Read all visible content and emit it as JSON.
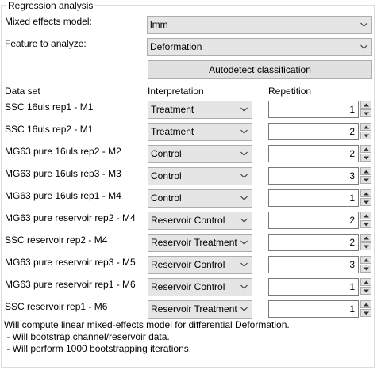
{
  "group_title": "Regression analysis",
  "model": {
    "label": "Mixed effects model:",
    "value": "lmm"
  },
  "feature": {
    "label": "Feature to analyze:",
    "value": "Deformation"
  },
  "autodetect_label": "Autodetect classification",
  "headers": {
    "dataset": "Data set",
    "interpretation": "Interpretation",
    "repetition": "Repetition"
  },
  "rows": [
    {
      "name": "SSC 16uls rep1 - M1",
      "interpretation": "Treatment",
      "repetition": "1"
    },
    {
      "name": "SSC 16uls rep2 - M1",
      "interpretation": "Treatment",
      "repetition": "2"
    },
    {
      "name": "MG63 pure 16uls rep2 - M2",
      "interpretation": "Control",
      "repetition": "2"
    },
    {
      "name": "MG63 pure 16uls rep3 - M3",
      "interpretation": "Control",
      "repetition": "3"
    },
    {
      "name": "MG63 pure 16uls rep1 - M4",
      "interpretation": "Control",
      "repetition": "1"
    },
    {
      "name": "MG63 pure reservoir rep2 - M4",
      "interpretation": "Reservoir Control",
      "repetition": "2"
    },
    {
      "name": "SSC reservoir rep2 - M4",
      "interpretation": "Reservoir Treatment",
      "repetition": "2"
    },
    {
      "name": "MG63 pure reservoir rep3 - M5",
      "interpretation": "Reservoir Control",
      "repetition": "3"
    },
    {
      "name": "MG63 pure reservoir rep1 - M6",
      "interpretation": "Reservoir Control",
      "repetition": "1"
    },
    {
      "name": "SSC reservoir rep1 - M6",
      "interpretation": "Reservoir Treatment",
      "repetition": "1"
    }
  ],
  "footer": [
    "Will compute linear mixed-effects model for differential Deformation.",
    " - Will bootstrap channel/reservoir data.",
    " - Will perform 1000 bootstrapping iterations."
  ],
  "icons": {
    "dropdown": "chevron-down-icon",
    "spin_up": "arrow-up-icon",
    "spin_down": "arrow-down-icon"
  }
}
